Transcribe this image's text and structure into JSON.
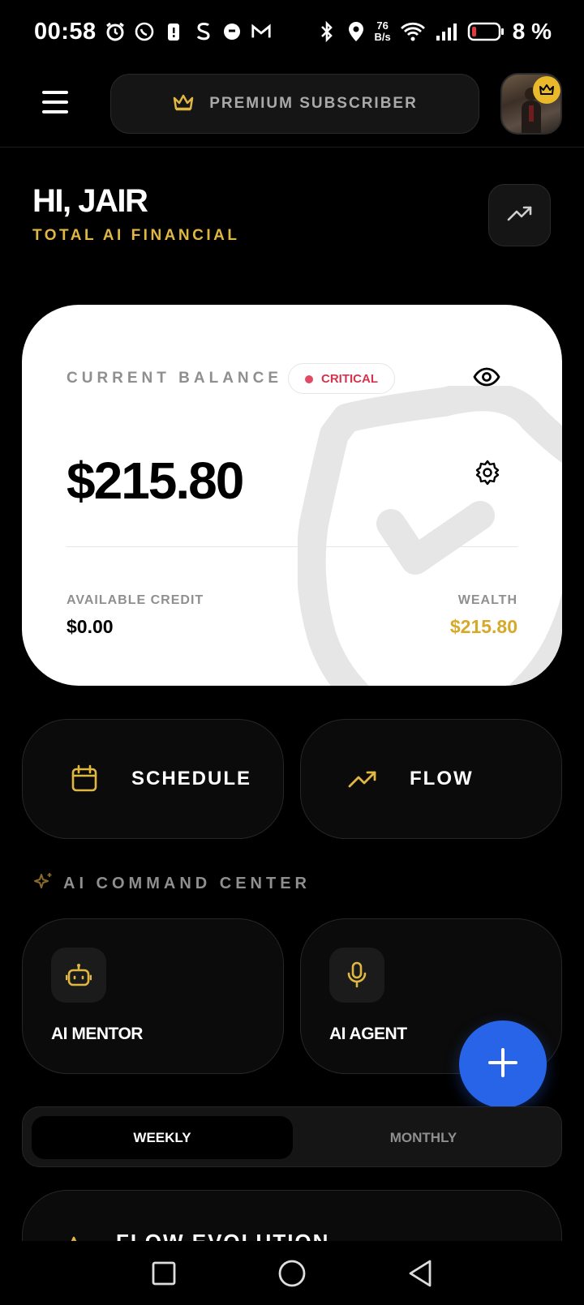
{
  "status_bar": {
    "time": "00:58",
    "net_speed_value": "76",
    "net_speed_unit": "B/s",
    "battery_percent": "8 %",
    "icons": [
      "alarm-icon",
      "whatsapp-icon",
      "battery-saver-icon",
      "s-app-icon",
      "chat-icon",
      "gmail-icon",
      "bluetooth-icon",
      "location-icon",
      "wifi-icon",
      "signal-icon",
      "battery-icon"
    ]
  },
  "header": {
    "premium_label": "PREMIUM SUBSCRIBER",
    "premium_icon": "crown-icon"
  },
  "greeting": {
    "title": "HI, JAIR",
    "subtitle": "TOTAL AI FINANCIAL"
  },
  "balance_card": {
    "label": "CURRENT BALANCE",
    "status": "CRITICAL",
    "amount": "$215.80",
    "credit_label": "AVAILABLE CREDIT",
    "credit_value": "$0.00",
    "wealth_label": "WEALTH",
    "wealth_value": "$215.80"
  },
  "actions": [
    {
      "label": "SCHEDULE",
      "icon": "calendar-icon"
    },
    {
      "label": "FLOW",
      "icon": "trending-up-icon"
    }
  ],
  "ai_section": {
    "title": "AI COMMAND CENTER",
    "cards": [
      {
        "label": "AI MENTOR",
        "icon": "robot-icon"
      },
      {
        "label": "AI AGENT",
        "icon": "microphone-icon"
      }
    ]
  },
  "tabs": {
    "weekly": "WEEKLY",
    "monthly": "MONTHLY",
    "selected": "WEEKLY"
  },
  "flow_card": {
    "title": "FLOW EVOLUTION"
  },
  "colors": {
    "gold": "#e0b743",
    "critical": "#d6334f",
    "fab_blue": "#2764e8",
    "background": "#000000"
  }
}
